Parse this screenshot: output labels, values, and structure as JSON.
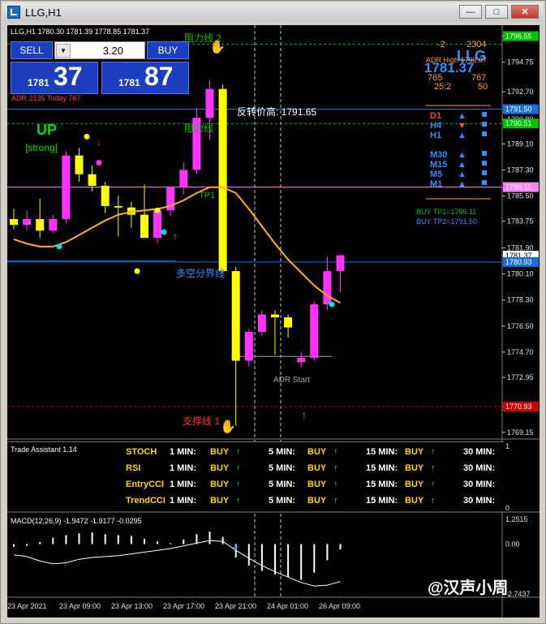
{
  "window": {
    "title": "LLG,H1"
  },
  "chart_header": "LLG,H1  1780.30 1781.39 1778.85 1781.37",
  "trade_panel": {
    "sell_label": "SELL",
    "buy_label": "BUY",
    "lot": "3.20",
    "sell_prefix": "1781",
    "sell_big": "37",
    "buy_prefix": "1781",
    "buy_big": "87"
  },
  "adr_text": "ADR 2135   Today 767",
  "info_panel": {
    "top_left": "-2",
    "top_right": "2304",
    "symbol": "LLG",
    "adr_high": "ADR High 1793.07",
    "price": "1781.37",
    "val1": "765",
    "val2": "767",
    "ratio": "25:2",
    "val3": "50"
  },
  "timeframes": [
    {
      "label": "D1",
      "color": "#ff4040",
      "dir": "up"
    },
    {
      "label": "H4",
      "color": "#3a8cff",
      "dir": "down"
    },
    {
      "label": "H1",
      "color": "#3a8cff",
      "dir": "up"
    },
    {
      "label": "M30",
      "color": "#3a8cff",
      "dir": "up"
    },
    {
      "label": "M15",
      "color": "#3a8cff",
      "dir": "up"
    },
    {
      "label": "M5",
      "color": "#3a8cff",
      "dir": "up"
    },
    {
      "label": "M1",
      "color": "#3a8cff",
      "dir": "up"
    }
  ],
  "tp_labels": {
    "tp1": "BUY TP1=1786.11",
    "tp2": "BUY TP2=1791.50"
  },
  "annotations": {
    "up": "UP",
    "strong": "[strong]",
    "reversal_high": "反转价高: 1791.65",
    "resistance1": "阻力线 2",
    "resistance2": "阻力线",
    "support": "支撑线 1",
    "bull_line": "多空分界线",
    "tp1_mark": "TP1",
    "adr_start": "ADR Start",
    "watermark": "@汉声小周"
  },
  "chart_data": {
    "type": "candlestick",
    "symbol": "LLG",
    "timeframe": "H1",
    "ohlc_header": {
      "open": 1780.3,
      "high": 1781.39,
      "low": 1778.85,
      "close": 1781.37
    },
    "ylim": [
      1768.8,
      1797.2
    ],
    "y_ticks": [
      1796.55,
      1794.75,
      1792.7,
      1790.8,
      1789.1,
      1787.3,
      1785.5,
      1783.75,
      1781.9,
      1781.37,
      1780.1,
      1778.3,
      1776.5,
      1774.7,
      1772.95,
      1770.93,
      1769.15
    ],
    "price_tags": [
      {
        "value": 1796.55,
        "color": "#00c000"
      },
      {
        "value": 1791.5,
        "color": "#1e6fd8"
      },
      {
        "value": 1790.51,
        "color": "#00c000"
      },
      {
        "value": 1786.11,
        "color": "#ff80ff"
      },
      {
        "value": 1781.37,
        "color": "#ffffff"
      },
      {
        "value": 1780.93,
        "color": "#1e6fd8"
      },
      {
        "value": 1770.93,
        "color": "#d00000"
      }
    ],
    "x_labels": [
      "23 Apr 2021",
      "23 Apr 09:00",
      "23 Apr 13:00",
      "23 Apr 17:00",
      "23 Apr 21:00",
      "24 Apr 01:00",
      "26 Apr 09:00"
    ],
    "candles": [
      {
        "o": 1783.9,
        "h": 1784.6,
        "l": 1783.2,
        "c": 1783.5
      },
      {
        "o": 1783.5,
        "h": 1784.5,
        "l": 1783.1,
        "c": 1783.9
      },
      {
        "o": 1783.9,
        "h": 1785.3,
        "l": 1782.6,
        "c": 1783.1
      },
      {
        "o": 1783.1,
        "h": 1784.2,
        "l": 1782.9,
        "c": 1783.9
      },
      {
        "o": 1783.9,
        "h": 1788.6,
        "l": 1783.6,
        "c": 1788.3
      },
      {
        "o": 1788.3,
        "h": 1788.8,
        "l": 1786.5,
        "c": 1787.0
      },
      {
        "o": 1787.0,
        "h": 1787.6,
        "l": 1785.8,
        "c": 1786.2
      },
      {
        "o": 1786.2,
        "h": 1786.5,
        "l": 1784.3,
        "c": 1784.8
      },
      {
        "o": 1784.8,
        "h": 1785.5,
        "l": 1782.7,
        "c": 1784.7
      },
      {
        "o": 1784.7,
        "h": 1785.1,
        "l": 1783.3,
        "c": 1784.2
      },
      {
        "o": 1784.2,
        "h": 1786.3,
        "l": 1782.7,
        "c": 1782.6
      },
      {
        "o": 1782.6,
        "h": 1784.6,
        "l": 1782.2,
        "c": 1784.5
      },
      {
        "o": 1784.5,
        "h": 1785.9,
        "l": 1784.1,
        "c": 1786.1
      },
      {
        "o": 1786.1,
        "h": 1787.8,
        "l": 1785.6,
        "c": 1787.3
      },
      {
        "o": 1787.3,
        "h": 1791.6,
        "l": 1787.0,
        "c": 1790.9
      },
      {
        "o": 1790.9,
        "h": 1793.5,
        "l": 1789.4,
        "c": 1792.9
      },
      {
        "o": 1792.9,
        "h": 1793.2,
        "l": 1780.2,
        "c": 1780.3
      },
      {
        "o": 1780.3,
        "h": 1780.6,
        "l": 1769.6,
        "c": 1774.1
      },
      {
        "o": 1774.1,
        "h": 1776.3,
        "l": 1773.7,
        "c": 1776.1
      },
      {
        "o": 1776.1,
        "h": 1777.6,
        "l": 1775.8,
        "c": 1777.3
      },
      {
        "o": 1777.3,
        "h": 1777.6,
        "l": 1774.5,
        "c": 1777.1
      },
      {
        "o": 1777.1,
        "h": 1777.3,
        "l": 1775.7,
        "c": 1776.4
      },
      {
        "o": 1774.0,
        "h": 1774.7,
        "l": 1773.6,
        "c": 1774.3
      },
      {
        "o": 1774.3,
        "h": 1778.2,
        "l": 1774.1,
        "c": 1778.0
      },
      {
        "o": 1778.0,
        "h": 1781.3,
        "l": 1777.6,
        "c": 1780.3
      },
      {
        "o": 1780.3,
        "h": 1781.4,
        "l": 1778.8,
        "c": 1781.4
      }
    ],
    "ma_line": [
      1782.5,
      1782.2,
      1782.0,
      1782.0,
      1782.3,
      1782.8,
      1783.3,
      1783.8,
      1784.2,
      1784.4,
      1784.5,
      1784.6,
      1784.8,
      1785.2,
      1785.7,
      1786.1,
      1786.1,
      1785.7,
      1784.6,
      1783.4,
      1782.2,
      1781.1,
      1780.2,
      1779.3,
      1778.6,
      1778.1
    ],
    "levels": [
      {
        "value": 1791.5,
        "color": "#1e6fd8",
        "style": "solid"
      },
      {
        "value": 1790.51,
        "color": "#00c000",
        "style": "dash"
      },
      {
        "value": 1786.11,
        "color": "#ff80ff",
        "style": "solid"
      },
      {
        "value": 1780.93,
        "color": "#1e6fd8",
        "style": "solid"
      },
      {
        "value": 1770.93,
        "color": "#d00000",
        "style": "dash"
      },
      {
        "value": 1796.0,
        "color": "#00c000",
        "style": "dash"
      }
    ]
  },
  "assistant": {
    "title": "Trade Assistant 1.14",
    "rows": [
      {
        "name": "STOCH",
        "cells": [
          {
            "tf": "1 MIN:",
            "sig": "BUY"
          },
          {
            "tf": "5 MIN:",
            "sig": "BUY"
          },
          {
            "tf": "15 MIN:",
            "sig": "BUY"
          },
          {
            "tf": "30 MIN:",
            "sig": ""
          }
        ]
      },
      {
        "name": "RSI",
        "cells": [
          {
            "tf": "1 MIN:",
            "sig": "BUY"
          },
          {
            "tf": "5 MIN:",
            "sig": "BUY"
          },
          {
            "tf": "15 MIN:",
            "sig": "BUY"
          },
          {
            "tf": "30 MIN:",
            "sig": ""
          }
        ]
      },
      {
        "name": "EntryCCI",
        "cells": [
          {
            "tf": "1 MIN:",
            "sig": "BUY"
          },
          {
            "tf": "5 MIN:",
            "sig": "BUY"
          },
          {
            "tf": "15 MIN:",
            "sig": "BUY"
          },
          {
            "tf": "30 MIN:",
            "sig": ""
          }
        ]
      },
      {
        "name": "TrendCCI",
        "cells": [
          {
            "tf": "1 MIN:",
            "sig": "BUY"
          },
          {
            "tf": "5 MIN:",
            "sig": "BUY"
          },
          {
            "tf": "15 MIN:",
            "sig": "BUY"
          },
          {
            "tf": "30 MIN:",
            "sig": ""
          }
        ]
      }
    ],
    "scale_top": "1",
    "scale_bottom": "0"
  },
  "macd": {
    "label": "MACD(12,26,9) -1.9472 -1.9177 -0.0295",
    "scale_top": "1.2515",
    "scale_mid": "0.00",
    "scale_bottom": "-2.7437",
    "histogram": [
      -0.15,
      -0.1,
      0.12,
      0.35,
      0.5,
      0.6,
      0.65,
      0.55,
      0.5,
      0.45,
      0.3,
      0.15,
      0.05,
      0.25,
      0.55,
      0.7,
      0.4,
      -0.75,
      -1.2,
      -1.5,
      -1.7,
      -1.85,
      -2.0,
      -1.6,
      -0.9,
      -0.3
    ],
    "signal": [
      -0.6,
      -0.7,
      -0.95,
      -1.1,
      -1.05,
      -0.85,
      -0.75,
      -0.7,
      -0.65,
      -0.55,
      -0.45,
      -0.35,
      -0.25,
      -0.1,
      0.05,
      0.2,
      0.15,
      -0.35,
      -0.8,
      -1.2,
      -1.55,
      -1.85,
      -2.15,
      -2.35,
      -2.3,
      -2.1
    ]
  }
}
